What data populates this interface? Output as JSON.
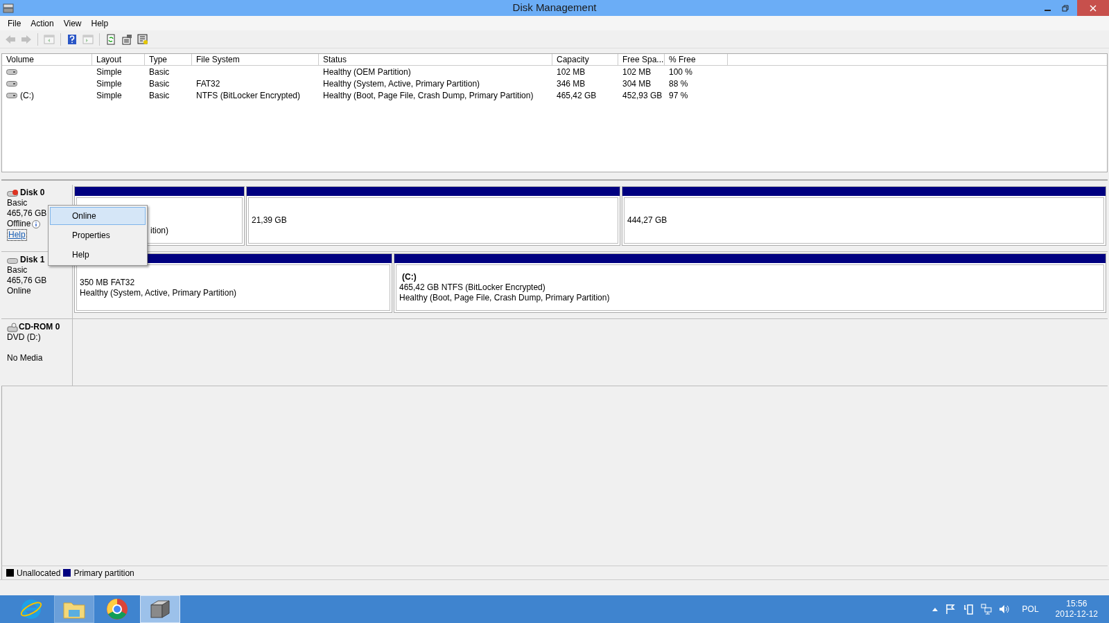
{
  "window": {
    "title": "Disk Management"
  },
  "menu": [
    "File",
    "Action",
    "View",
    "Help"
  ],
  "toolbar": [
    {
      "kind": "back",
      "disabled": true
    },
    {
      "kind": "forward",
      "disabled": true
    },
    {
      "kind": "sep"
    },
    {
      "kind": "pane",
      "disabled": true
    },
    {
      "kind": "sep"
    },
    {
      "kind": "help",
      "disabled": false
    },
    {
      "kind": "pane2",
      "disabled": true
    },
    {
      "kind": "sep"
    },
    {
      "kind": "refresh",
      "disabled": false
    },
    {
      "kind": "props",
      "disabled": false
    },
    {
      "kind": "rescan",
      "disabled": false
    }
  ],
  "table": {
    "columns": [
      "Volume",
      "Layout",
      "Type",
      "File System",
      "Status",
      "Capacity",
      "Free Spa...",
      "% Free"
    ],
    "rows": [
      [
        "",
        "Simple",
        "Basic",
        "",
        "Healthy (OEM Partition)",
        "102 MB",
        "102 MB",
        "100 %"
      ],
      [
        "",
        "Simple",
        "Basic",
        "FAT32",
        "Healthy (System, Active, Primary Partition)",
        "346 MB",
        "304 MB",
        "88 %"
      ],
      [
        "(C:)",
        "Simple",
        "Basic",
        "NTFS (BitLocker Encrypted)",
        "Healthy (Boot, Page File, Crash Dump, Primary Partition)",
        "465,42 GB",
        "452,93 GB",
        "97 %"
      ]
    ]
  },
  "disks": [
    {
      "kind": "disk",
      "name": "Disk 0",
      "lines": [
        "Basic",
        "465,76 GB",
        "Offline"
      ],
      "offline": true,
      "link": "Help",
      "partitions": [
        {
          "color": "#000080",
          "lines": [
            "ition)"
          ]
        },
        {
          "color": "#000080",
          "lines": [
            "21,39 GB"
          ]
        },
        {
          "color": "#000080",
          "lines": [
            "444,27 GB"
          ]
        }
      ]
    },
    {
      "kind": "disk",
      "name": "Disk 1",
      "lines": [
        "Basic",
        "465,76 GB",
        "Online"
      ],
      "offline": false,
      "partitions": [
        {
          "color": "#000080",
          "lines": [
            "350 MB FAT32",
            "Healthy (System, Active, Primary Partition)"
          ]
        },
        {
          "color": "#000080",
          "label": "(C:)",
          "lines": [
            "465,42 GB NTFS (BitLocker Encrypted)",
            "Healthy (Boot, Page File, Crash Dump, Primary Partition)"
          ]
        }
      ]
    },
    {
      "kind": "cdrom",
      "name": "CD-ROM 0",
      "lines": [
        "DVD (D:)",
        "No Media"
      ]
    }
  ],
  "context_menu": [
    {
      "label": "Online",
      "selected": true
    },
    {
      "label": "Properties",
      "selected": false
    },
    {
      "label": "Help",
      "selected": false
    }
  ],
  "legend": [
    {
      "label": "Unallocated",
      "color": "#000000"
    },
    {
      "label": "Primary partition",
      "color": "#000080"
    }
  ],
  "taskbar": {
    "apps": [
      {
        "kind": "browser",
        "selected": false,
        "running": false
      },
      {
        "kind": "folder",
        "selected": false,
        "running": true
      },
      {
        "kind": "chrome",
        "selected": false,
        "running": false
      },
      {
        "kind": "diskmgmt",
        "selected": true,
        "running": true
      }
    ],
    "language": "POL",
    "time": "15:56",
    "date": "2012-12-12"
  }
}
